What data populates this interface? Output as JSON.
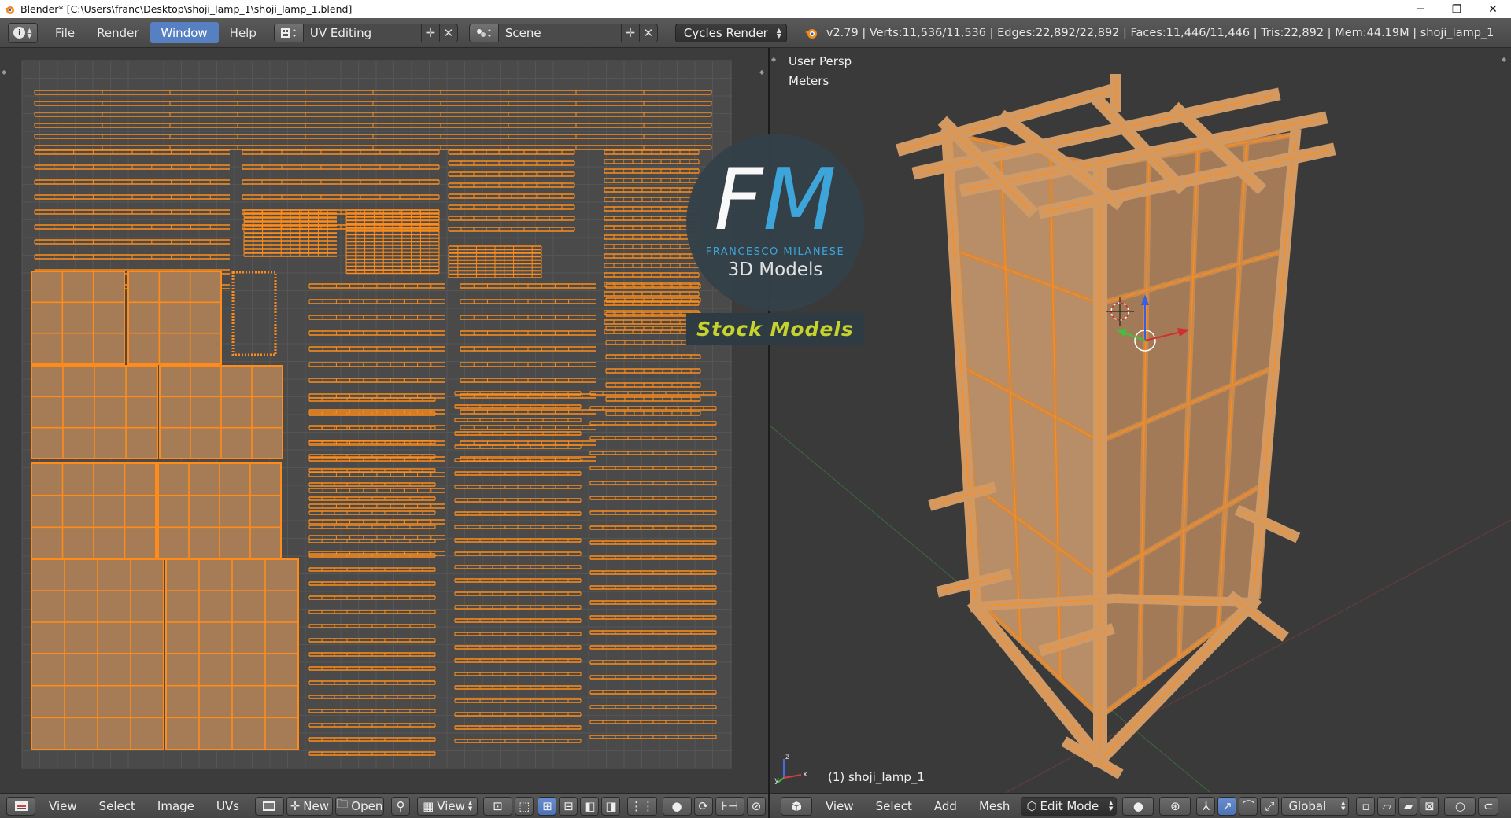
{
  "window": {
    "title": "Blender* [C:\\Users\\franc\\Desktop\\shoji_lamp_1\\shoji_lamp_1.blend]",
    "minimize": "─",
    "maximize": "❐",
    "close": "✕"
  },
  "menubar": {
    "items": [
      "File",
      "Render",
      "Window",
      "Help"
    ],
    "active_item": "Window",
    "screen_layout": "UV Editing",
    "scene": "Scene",
    "render_engine": "Cycles Render",
    "stats": "v2.79 | Verts:11,536/11,536 | Edges:22,892/22,892 | Faces:11,446/11,446 | Tris:22,892 | Mem:44.19M | shoji_lamp_1"
  },
  "viewport": {
    "view_name": "User Persp",
    "units": "Meters",
    "object_label": "(1) shoji_lamp_1"
  },
  "uv_header": {
    "menus": [
      "View",
      "Select",
      "Image",
      "UVs"
    ],
    "new_label": "New",
    "open_label": "Open",
    "view_label": "View"
  },
  "view3d_header": {
    "menus": [
      "View",
      "Select",
      "Add",
      "Mesh"
    ],
    "mode": "Edit Mode",
    "orientation": "Global"
  },
  "overlay": {
    "logo_letters": "FM",
    "brand_name": "FRANCESCO MILANESE",
    "brand_sub": "3D Models",
    "stock_label": "Stock Models"
  },
  "colors": {
    "accent_active": "#5680c2",
    "uv_orange": "#ff8c1a",
    "face_fill": "#a57c55",
    "logo_blue": "#3fa9e0",
    "stock_yellow": "#c6d22d"
  }
}
